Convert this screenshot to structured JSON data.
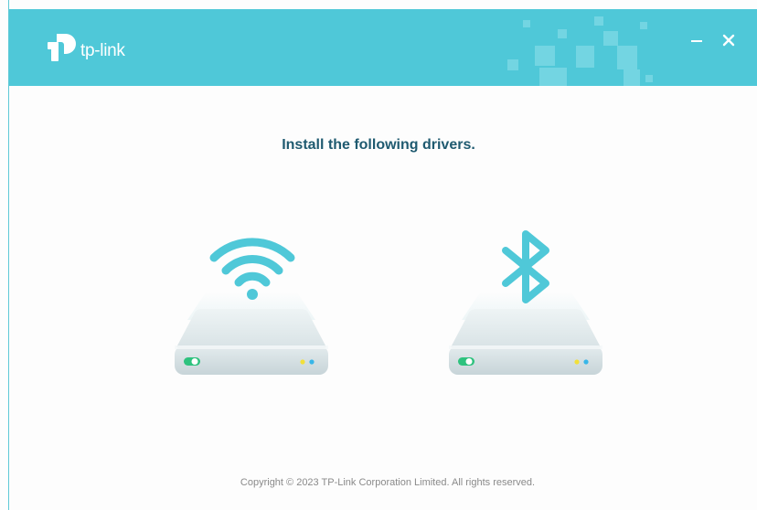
{
  "header": {
    "brand": "tp-link",
    "minimize_glyph": "–",
    "close_glyph": "×",
    "logo_icon": "tp-link-logo-icon",
    "minimize_icon": "minimize-icon",
    "close_icon": "close-icon"
  },
  "main": {
    "heading": "Install the following drivers.",
    "drivers": [
      {
        "name": "wifi",
        "icon": "wifi-icon"
      },
      {
        "name": "bluetooth",
        "icon": "bluetooth-icon"
      }
    ]
  },
  "footer": {
    "copyright": "Copyright © 2023 TP-Link Corporation Limited. All rights reserved."
  },
  "colors": {
    "header_bg": "#4fc8d8",
    "accent": "#4fc8d8",
    "heading_text": "#1f5a70",
    "footer_text": "#8a8a8a"
  }
}
